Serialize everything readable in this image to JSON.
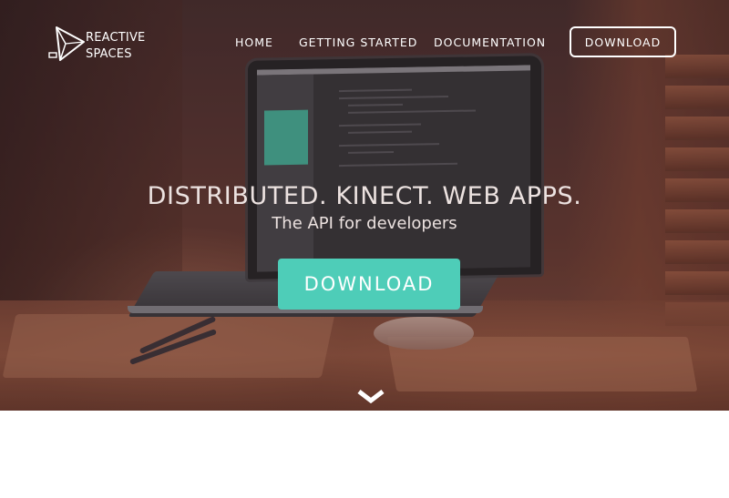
{
  "brand": {
    "name_line1": "REACTIVE",
    "name_line2": "SPACES",
    "logo_icon": "paper-plane-logo-icon"
  },
  "nav": {
    "items": [
      {
        "label": "HOME"
      },
      {
        "label": "GETTING STARTED"
      },
      {
        "label": "DOCUMENTATION"
      }
    ],
    "download_label": "DOWNLOAD"
  },
  "hero": {
    "headline": "DISTRIBUTED. KINECT. WEB APPS.",
    "subheadline": "The API for developers",
    "cta_label": "DOWNLOAD",
    "scroll_icon": "chevron-down-icon"
  },
  "colors": {
    "accent": "#4ecdb8",
    "text": "#ffffff",
    "page_background": "#ffffff"
  }
}
